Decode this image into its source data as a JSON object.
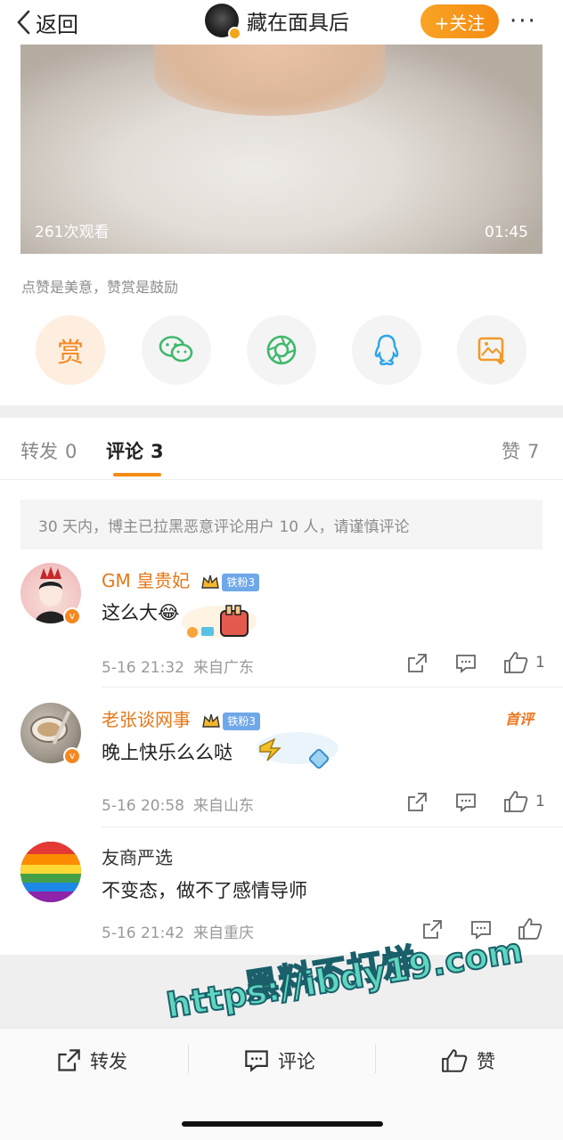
{
  "header": {
    "back_label": "返回",
    "user_name": "藏在面具后",
    "follow_label": "+关注",
    "more_label": "···"
  },
  "video": {
    "views": "261次观看",
    "duration": "01:45"
  },
  "reward_tip": "点赞是美意，赞赏是鼓励",
  "share": {
    "reward_label": "赏",
    "items": [
      "reward-button",
      "wechat-icon",
      "moments-icon",
      "qq-icon",
      "save-image-icon"
    ]
  },
  "tabs": {
    "repost_label": "转发",
    "repost_count": "0",
    "comment_label": "评论",
    "comment_count": "3",
    "like_label": "赞",
    "like_count": "7"
  },
  "notice": "30 天内，博主已拉黑恶意评论用户 10 人，请谨慎评论",
  "comments": [
    {
      "name": "GM 皇贵妃",
      "fan_badge": "铁粉3",
      "text": "这么大😂",
      "time": "5-16 21:32",
      "place": "来自广东",
      "likes": "1"
    },
    {
      "name": "老张谈网事",
      "fan_badge": "铁粉3",
      "first_tag": "首评",
      "text": "晚上快乐么么哒",
      "time": "5-16 20:58",
      "place": "来自山东",
      "likes": "1"
    },
    {
      "name": "友商严选",
      "text": "不变态，做不了感情导师",
      "time": "5-16 21:42",
      "place": "来自重庆",
      "likes": ""
    }
  ],
  "bottom_bar": {
    "repost": "转发",
    "comment": "评论",
    "like": "赞"
  },
  "watermark": {
    "line1": "黑料不打烊",
    "line2": "https://ibdy19.com"
  },
  "colors": {
    "accent": "#f58b12",
    "name_orange": "#e5781a",
    "fan_badge": "#6fa8e8"
  }
}
